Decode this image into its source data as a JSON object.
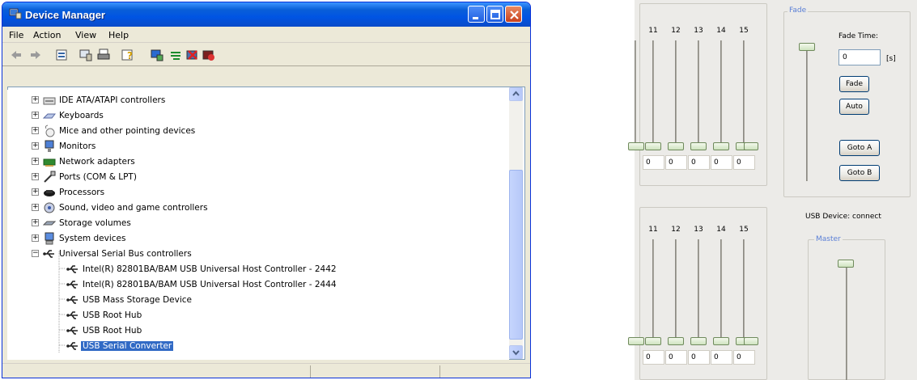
{
  "device_manager": {
    "title": "Device Manager",
    "menu": [
      "File",
      "Action",
      "View",
      "Help"
    ],
    "toolbar_icons": [
      "back-arrow-icon",
      "forward-arrow-icon",
      "properties-icon",
      "computer-icon",
      "print-icon",
      "help-icon",
      "scan-hardware-icon",
      "update-driver-icon",
      "uninstall-icon",
      "disable-icon"
    ],
    "tree": [
      {
        "label": "IDE ATA/ATAPI controllers",
        "icon": "ide-controller-icon",
        "expanded": false
      },
      {
        "label": "Keyboards",
        "icon": "keyboard-icon",
        "expanded": false
      },
      {
        "label": "Mice and other pointing devices",
        "icon": "mouse-icon",
        "expanded": false
      },
      {
        "label": "Monitors",
        "icon": "monitor-icon",
        "expanded": false
      },
      {
        "label": "Network adapters",
        "icon": "network-adapter-icon",
        "expanded": false
      },
      {
        "label": "Ports (COM & LPT)",
        "icon": "port-icon",
        "expanded": false
      },
      {
        "label": "Processors",
        "icon": "processor-icon",
        "expanded": false
      },
      {
        "label": "Sound, video and game controllers",
        "icon": "sound-icon",
        "expanded": false
      },
      {
        "label": "Storage volumes",
        "icon": "storage-icon",
        "expanded": false
      },
      {
        "label": "System devices",
        "icon": "system-icon",
        "expanded": false
      },
      {
        "label": "Universal Serial Bus controllers",
        "icon": "usb-icon",
        "expanded": true
      }
    ],
    "usb_children": [
      "Intel(R) 82801BA/BAM USB Universal Host Controller - 2442",
      "Intel(R) 82801BA/BAM USB Universal Host Controller - 2444",
      "USB Mass Storage Device",
      "USB Root Hub",
      "USB Root Hub",
      "USB Serial Converter"
    ],
    "selected_item": "USB Serial Converter"
  },
  "mixer": {
    "channels": [
      "11",
      "12",
      "13",
      "14",
      "15"
    ],
    "bank_a_values": [
      "0",
      "0",
      "0",
      "0",
      "0"
    ],
    "bank_b_values": [
      "0",
      "0",
      "0",
      "0",
      "0"
    ],
    "fade_group_label": "Fade",
    "fade_time_label": "Fade Time:",
    "fade_time_value": "0",
    "fade_time_unit": "[s]",
    "buttons": {
      "fade": "Fade",
      "auto": "Auto",
      "goto_a": "Goto A",
      "goto_b": "Goto B"
    },
    "usb_status": "USB Device: connect",
    "master_label": "Master"
  }
}
